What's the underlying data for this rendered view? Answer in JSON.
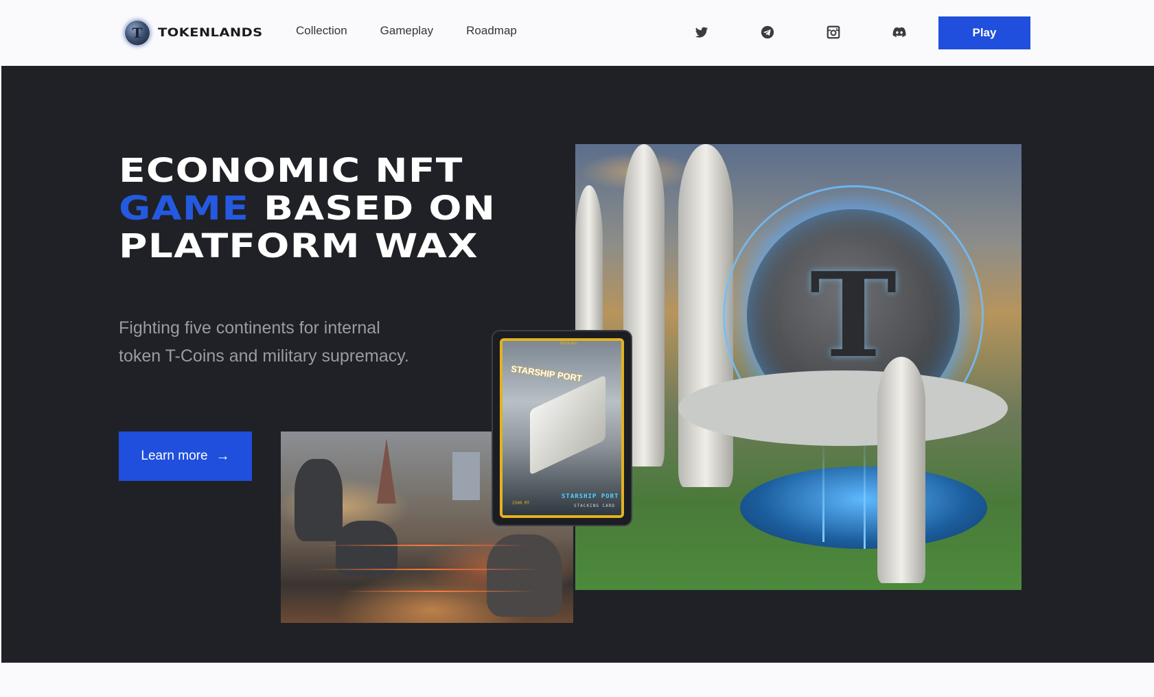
{
  "header": {
    "brand": "TOKENLANDS",
    "logo_glyph": "T",
    "nav": [
      {
        "label": "Collection"
      },
      {
        "label": "Gameplay"
      },
      {
        "label": "Roadmap"
      }
    ],
    "social_icons": [
      "twitter-icon",
      "telegram-icon",
      "instagram-icon",
      "discord-icon"
    ],
    "play_label": "Play"
  },
  "hero": {
    "headline_line1": "ECONOMIC NFT",
    "headline_accent": "GAME",
    "headline_line2_rest": " BASED ON",
    "headline_line3": "PLATFORM WAX",
    "subtitle": "Fighting five continents for internal token T-Coins and military supremacy.",
    "learn_more_label": "Learn more",
    "learn_more_icon": "arrow-right-icon"
  },
  "card": {
    "title": "STARSHIP PORT",
    "name": "STARSHIP PORT",
    "type": "STACKING CARD",
    "cost": "2500 MT",
    "rarity": "REGULARS"
  },
  "colors": {
    "accent": "#1f4fdc",
    "headline_accent": "#2459e0",
    "hero_bg": "#1f2127",
    "page_bg": "#fafafc"
  }
}
